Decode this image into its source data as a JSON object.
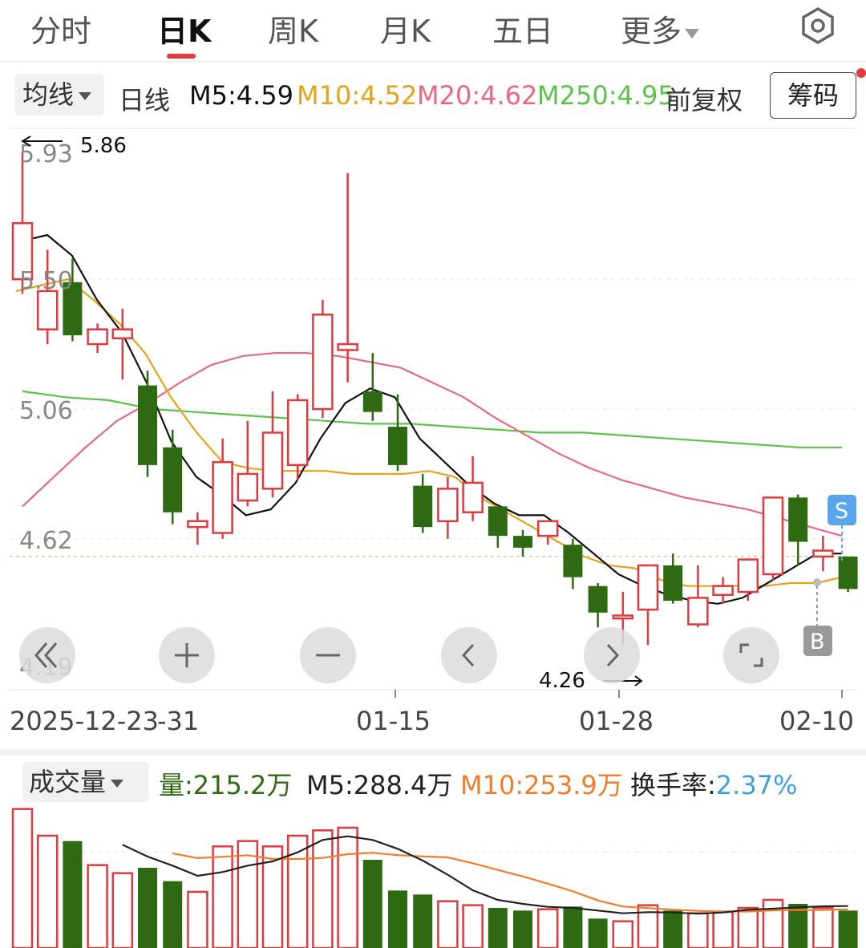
{
  "tabs": [
    {
      "label": "分时"
    },
    {
      "label": "日K"
    },
    {
      "label": "周K"
    },
    {
      "label": "月K"
    },
    {
      "label": "五日"
    },
    {
      "label": "更多"
    }
  ],
  "indicators": {
    "ma_selector": "均线",
    "period": "日线",
    "m5": "M5:4.59",
    "m10": "M10:4.52",
    "m20": "M20:4.62",
    "m250": "M250:4.95",
    "adjust": "前复权",
    "chips_button": "筹码"
  },
  "colors": {
    "up": "#e0393e",
    "down": "#2d6a12",
    "m5": "#111111",
    "m10": "#e6a21a",
    "m20": "#e8697f",
    "m250": "#5cc24a",
    "turnover": "#3fa0e0",
    "vol_m10": "#f07b2b"
  },
  "chart_data": {
    "type": "candlestick",
    "y_ticks": [
      "5.93",
      "5.50",
      "5.06",
      "4.62",
      "4.19"
    ],
    "ylim": [
      4.19,
      5.93
    ],
    "max_label": "5.86",
    "min_label": "4.26",
    "x_labels": [
      "2025-12-23",
      "31",
      "01-15",
      "01-28",
      "02-10"
    ],
    "candles": [
      {
        "o": 5.5,
        "h": 5.93,
        "l": 5.45,
        "c": 5.69
      },
      {
        "o": 5.33,
        "h": 5.6,
        "l": 5.28,
        "c": 5.46
      },
      {
        "o": 5.49,
        "h": 5.57,
        "l": 5.29,
        "c": 5.31
      },
      {
        "o": 5.28,
        "h": 5.35,
        "l": 5.25,
        "c": 5.33
      },
      {
        "o": 5.3,
        "h": 5.4,
        "l": 5.16,
        "c": 5.33
      },
      {
        "o": 5.14,
        "h": 5.19,
        "l": 4.83,
        "c": 4.87
      },
      {
        "o": 4.93,
        "h": 4.99,
        "l": 4.67,
        "c": 4.71
      },
      {
        "o": 4.66,
        "h": 4.71,
        "l": 4.6,
        "c": 4.68
      },
      {
        "o": 4.64,
        "h": 4.96,
        "l": 4.62,
        "c": 4.88
      },
      {
        "o": 4.75,
        "h": 5.02,
        "l": 4.73,
        "c": 4.84
      },
      {
        "o": 4.79,
        "h": 5.12,
        "l": 4.76,
        "c": 4.98
      },
      {
        "o": 4.87,
        "h": 5.11,
        "l": 4.82,
        "c": 5.09
      },
      {
        "o": 5.06,
        "h": 5.43,
        "l": 5.03,
        "c": 5.38
      },
      {
        "o": 5.26,
        "h": 5.86,
        "l": 5.15,
        "c": 5.28
      },
      {
        "o": 5.12,
        "h": 5.25,
        "l": 5.02,
        "c": 5.05
      },
      {
        "o": 5.0,
        "h": 5.11,
        "l": 4.85,
        "c": 4.87
      },
      {
        "o": 4.8,
        "h": 4.84,
        "l": 4.64,
        "c": 4.66
      },
      {
        "o": 4.68,
        "h": 4.83,
        "l": 4.62,
        "c": 4.79
      },
      {
        "o": 4.71,
        "h": 4.9,
        "l": 4.68,
        "c": 4.81
      },
      {
        "o": 4.73,
        "h": 4.73,
        "l": 4.59,
        "c": 4.63
      },
      {
        "o": 4.63,
        "h": 4.65,
        "l": 4.56,
        "c": 4.59
      },
      {
        "o": 4.63,
        "h": 4.68,
        "l": 4.6,
        "c": 4.68
      },
      {
        "o": 4.6,
        "h": 4.62,
        "l": 4.45,
        "c": 4.49
      },
      {
        "o": 4.46,
        "h": 4.47,
        "l": 4.32,
        "c": 4.37
      },
      {
        "o": 4.35,
        "h": 4.44,
        "l": 4.26,
        "c": 4.36
      },
      {
        "o": 4.38,
        "h": 4.53,
        "l": 4.26,
        "c": 4.53
      },
      {
        "o": 4.53,
        "h": 4.57,
        "l": 4.4,
        "c": 4.41
      },
      {
        "o": 4.33,
        "h": 4.53,
        "l": 4.32,
        "c": 4.42
      },
      {
        "o": 4.43,
        "h": 4.49,
        "l": 4.4,
        "c": 4.46
      },
      {
        "o": 4.44,
        "h": 4.51,
        "l": 4.41,
        "c": 4.55
      },
      {
        "o": 4.5,
        "h": 4.76,
        "l": 4.48,
        "c": 4.76
      },
      {
        "o": 4.76,
        "h": 4.77,
        "l": 4.53,
        "c": 4.61
      },
      {
        "o": 4.56,
        "h": 4.63,
        "l": 4.51,
        "c": 4.58
      },
      {
        "o": 4.56,
        "h": 4.56,
        "l": 4.44,
        "c": 4.45
      }
    ],
    "ma5": [
      5.63,
      5.65,
      5.58,
      5.43,
      5.32,
      5.15,
      4.95,
      4.83,
      4.77,
      4.7,
      4.72,
      4.81,
      4.96,
      5.08,
      5.13,
      5.1,
      4.96,
      4.88,
      4.8,
      4.74,
      4.7,
      4.7,
      4.64,
      4.57,
      4.5,
      4.46,
      4.43,
      4.41,
      4.4,
      4.42,
      4.47,
      4.52,
      4.57,
      4.57
    ],
    "ma10": [
      5.46,
      5.48,
      5.5,
      5.43,
      5.35,
      5.25,
      5.1,
      4.98,
      4.88,
      4.86,
      4.85,
      4.85,
      4.85,
      4.84,
      4.84,
      4.84,
      4.85,
      4.83,
      4.76,
      4.71,
      4.66,
      4.61,
      4.56,
      4.53,
      4.52,
      4.48,
      4.46,
      4.46,
      4.46,
      4.46,
      4.47,
      4.47,
      4.49
    ],
    "ma20": [
      4.73,
      4.83,
      4.93,
      5.02,
      5.08,
      5.15,
      5.21,
      5.24,
      5.25,
      5.25,
      5.24,
      5.22,
      5.2,
      5.15,
      5.1,
      5.03,
      4.97,
      4.91,
      4.86,
      4.82,
      4.79,
      4.76,
      4.74,
      4.72,
      4.69,
      4.66,
      4.63
    ],
    "ma250": [
      5.12,
      5.1,
      5.09,
      5.06,
      5.05,
      5.04,
      5.03,
      5.02,
      5.01,
      5.01,
      5.0,
      4.99,
      4.98,
      4.98,
      4.97,
      4.96,
      4.95,
      4.94,
      4.93,
      4.93
    ],
    "marker_s": "S",
    "marker_b": "B",
    "volume_title": "成交量",
    "volume": [
      520,
      420,
      400,
      310,
      280,
      300,
      250,
      210,
      380,
      400,
      380,
      420,
      440,
      450,
      330,
      215,
      200,
      175,
      160,
      150,
      140,
      145,
      155,
      110,
      100,
      160,
      140,
      130,
      135,
      150,
      180,
      165,
      150,
      140
    ],
    "volume_ylim": [
      0,
      540
    ]
  },
  "volume_indicators": {
    "selector": "成交量",
    "volume": "量:215.2万",
    "m5": "M5:288.4万",
    "m10": "M10:253.9万",
    "turnover_label": "换手率:",
    "turnover_value": "2.37%"
  }
}
